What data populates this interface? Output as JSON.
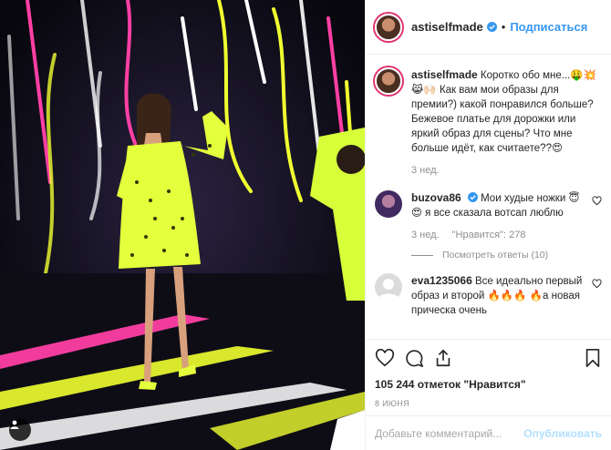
{
  "post": {
    "username": "astiselfmade",
    "follow_label": "Подписаться",
    "dot": "•"
  },
  "caption": {
    "username": "astiselfmade",
    "text": "Коротко обо мне...🤑💥😹🙌🏻 Как вам мои образы для премии?) какой понравился больше? Бежевое платье для дорожки или яркий образ для сцены? Что мне больше идёт, как считаете??😍",
    "time": "3 нед."
  },
  "comments": [
    {
      "username": "buzova86",
      "verified": true,
      "text": "Мои худые ножки 😇😍 я все сказала вотсап люблю",
      "time": "3 нед.",
      "likes": "\"Нравится\": 278",
      "replies": "Посмотреть ответы (10)"
    },
    {
      "username": "eva1235066",
      "verified": false,
      "text": "Все идеально первый образ и второй 🔥🔥🔥 🔥а новая прическа очень",
      "time": ""
    }
  ],
  "footer": {
    "likes": "105 244 отметок \"Нравится\"",
    "date": "8 ИЮНЯ",
    "add_placeholder": "Добавьте комментарий...",
    "publish_label": "Опубликовать"
  },
  "icons": {
    "like": "heart-icon",
    "comment": "comment-icon",
    "share": "share-icon",
    "save": "bookmark-icon",
    "user_tag": "user-tag-icon"
  },
  "colors": {
    "accent": "#3897f0",
    "verified": "#3897f0",
    "muted": "#8e8e8e",
    "publish_disabled": "#b2dffc"
  }
}
